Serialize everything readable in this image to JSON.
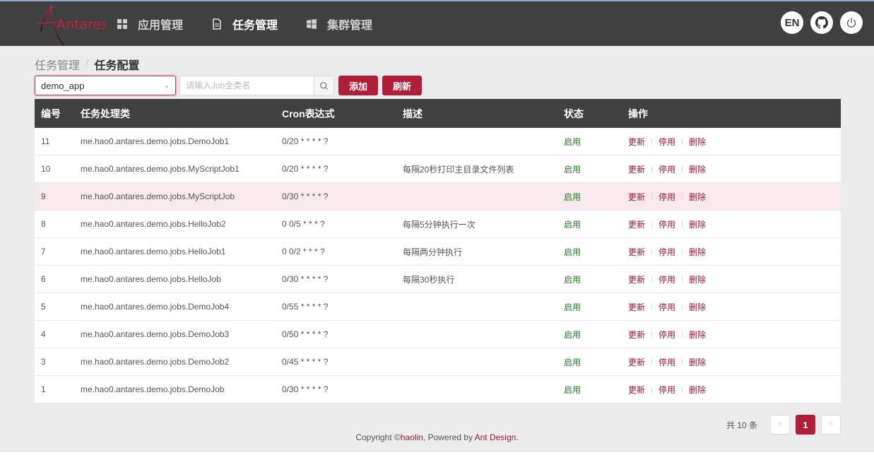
{
  "header": {
    "logo_text": "Antares",
    "nav": [
      {
        "label": "应用管理",
        "icon": "app-grid-icon",
        "active": false
      },
      {
        "label": "任务管理",
        "icon": "document-icon",
        "active": true
      },
      {
        "label": "集群管理",
        "icon": "windows-icon",
        "active": false
      }
    ],
    "lang_label": "EN",
    "github_icon": "github-icon",
    "power_icon": "power-icon"
  },
  "breadcrumb": {
    "first": "任务管理",
    "separator": "/",
    "last": "任务配置"
  },
  "toolbar": {
    "app_select_value": "demo_app",
    "search_placeholder": "请输入Job全类名",
    "add_label": "添加",
    "refresh_label": "刷新"
  },
  "table": {
    "columns": [
      "编号",
      "任务处理类",
      "Cron表达式",
      "描述",
      "状态",
      "操作"
    ],
    "rows": [
      {
        "id": "11",
        "cls": "me.hao0.antares.demo.jobs.DemoJob1",
        "cron": "0/20 * * * * ?",
        "desc": "",
        "status": "启用"
      },
      {
        "id": "10",
        "cls": "me.hao0.antares.demo.jobs.MyScriptJob1",
        "cron": "0/20 * * * * ?",
        "desc": "每隔20秒打印主目录文件列表",
        "status": "启用"
      },
      {
        "id": "9",
        "cls": "me.hao0.antares.demo.jobs.MyScriptJob",
        "cron": "0/30 * * * * ?",
        "desc": "",
        "status": "启用"
      },
      {
        "id": "8",
        "cls": "me.hao0.antares.demo.jobs.HelloJob2",
        "cron": "0 0/5 * * * ?",
        "desc": "每隔5分钟执行一次",
        "status": "启用"
      },
      {
        "id": "7",
        "cls": "me.hao0.antares.demo.jobs.HelloJob1",
        "cron": "0 0/2 * * * ?",
        "desc": "每隔两分钟执行",
        "status": "启用"
      },
      {
        "id": "6",
        "cls": "me.hao0.antares.demo.jobs.HelloJob",
        "cron": "0/30 * * * * ?",
        "desc": "每隔30秒执行",
        "status": "启用"
      },
      {
        "id": "5",
        "cls": "me.hao0.antares.demo.jobs.DemoJob4",
        "cron": "0/55 * * * * ?",
        "desc": "",
        "status": "启用"
      },
      {
        "id": "4",
        "cls": "me.hao0.antares.demo.jobs.DemoJob3",
        "cron": "0/50 * * * * ?",
        "desc": "",
        "status": "启用"
      },
      {
        "id": "3",
        "cls": "me.hao0.antares.demo.jobs.DemoJob2",
        "cron": "0/45 * * * * ?",
        "desc": "",
        "status": "启用"
      },
      {
        "id": "1",
        "cls": "me.hao0.antares.demo.jobs.DemoJob",
        "cron": "0/30 * * * * ?",
        "desc": "",
        "status": "启用"
      }
    ],
    "actions": {
      "update": "更新",
      "disable": "停用",
      "delete": "删除"
    },
    "highlighted_row_index": 2
  },
  "pagination": {
    "total_text": "共 10 条",
    "current_page": "1",
    "prev": "<",
    "next": ">"
  },
  "footer": {
    "prefix": "Copyright  ©",
    "author": "haolin",
    "middle": ", Powered by ",
    "link": "Ant Design",
    "suffix": "."
  },
  "colors": {
    "brand": "#b01e3a",
    "header_bg": "#404040",
    "status_enabled": "#1e7d1e"
  }
}
